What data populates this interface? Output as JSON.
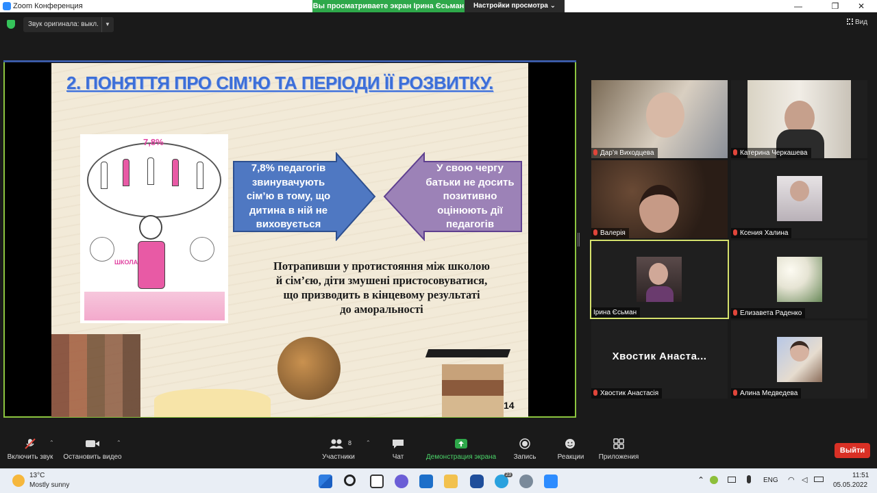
{
  "window": {
    "title": "Zoom Конференция",
    "share_banner": "Вы просматриваете экран Ірина Єсьман",
    "view_settings": "Настройки просмотра",
    "minimize": "—",
    "maximize": "❐",
    "close": "✕"
  },
  "topbar": {
    "original_sound": "Звук оригинала: выкл.",
    "view_label": "Вид"
  },
  "slide": {
    "title": "2.  ПОНЯТТЯ ПРО СІМ’Ю ТА ПЕРІОДИ ЇЇ РОЗВИТКУ.",
    "illustration_percent": "7,8%",
    "illustration_school": "ШКОЛА",
    "arrow_left_text": "7,8% педагогів звинувачують сім’ю в тому, що дитина в ній не виховується",
    "arrow_right_text": "У свою чергу батьки не досить позитивно оцінюють дії педагогів",
    "body_lines": [
      "Потрапивши у протистояння між школою",
      "й сім’єю, діти змушені пристосовуватися,",
      "що призводить в кінцевому результаті",
      "до аморальності"
    ],
    "page_number": "14",
    "colors": {
      "title": "#3d6fd8",
      "arrow_left": "#4f78c2",
      "arrow_right": "#9c82b7"
    }
  },
  "participants": [
    {
      "name": "Дар’я Виходцева",
      "muted": true
    },
    {
      "name": "Катерина Черкашева",
      "muted": true
    },
    {
      "name": "Валерія",
      "muted": true
    },
    {
      "name": "Ксения Халина",
      "muted": true
    },
    {
      "name": "Ірина Єсьман",
      "muted": false,
      "active_speaker": true
    },
    {
      "name": "Елизавета Раденко",
      "muted": true
    },
    {
      "name": "Хвостик Анастасія",
      "muted": true,
      "video_off_label": "Хвостик  Анаста..."
    },
    {
      "name": "Алина Медведева",
      "muted": true
    }
  ],
  "toolbar": {
    "unmute": "Включить звук",
    "stop_video": "Остановить видео",
    "participants": "Участники",
    "participants_count": "8",
    "chat": "Чат",
    "share_screen": "Демонстрация экрана",
    "record": "Запись",
    "reactions": "Реакции",
    "apps": "Приложения",
    "end": "Выйти"
  },
  "taskbar": {
    "weather_temp": "13°C",
    "weather_desc": "Mostly sunny",
    "language": "ENG",
    "time": "11:51",
    "date": "05.05.2022",
    "telegram_badge": "23"
  }
}
